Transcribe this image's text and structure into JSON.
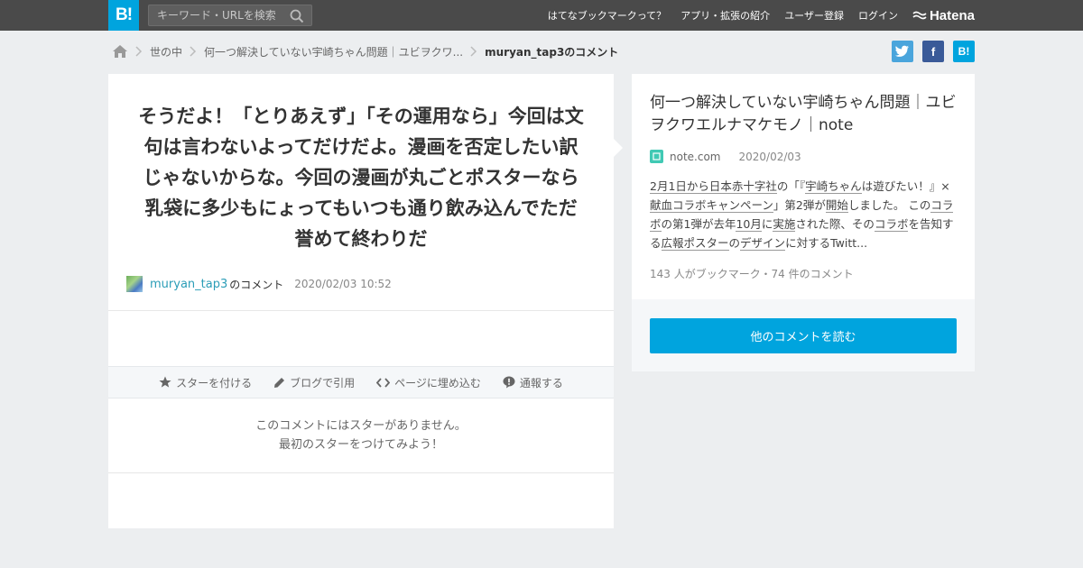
{
  "topbar": {
    "logo": "B!",
    "search_placeholder": "キーワード・URLを検索",
    "nav": [
      "はてなブックマークって？",
      "アプリ・拡張の紹介",
      "ユーザー登録",
      "ログイン"
    ],
    "brand": "Hatena"
  },
  "breadcrumb": {
    "items": [
      "世の中",
      "何一つ解決していない宇崎ちゃん問題｜ユビヲクワ..."
    ],
    "current": "muryan_tap3のコメント"
  },
  "share": {
    "facebook": "f",
    "hatena": "B!"
  },
  "comment": {
    "text": "そうだよ！「とりあえず」「その運用なら」今回は文句は言わないよってだけだよ。漫画を否定したい訳じゃないからな。今回の漫画が丸ごとポスターなら乳袋に多少もにょってもいつも通り飲み込んでただ誉めて終わりだ",
    "username": "muryan_tap3",
    "no_comment": "のコメント",
    "date": "2020/02/03 10:52"
  },
  "actions": {
    "star": "スターを付ける",
    "blog": "ブログで引用",
    "embed": "ページに埋め込む",
    "report": "通報する"
  },
  "no_stars": {
    "line1": "このコメントにはスターがありません。",
    "line2": "最初のスターをつけてみよう！"
  },
  "entry": {
    "title": "何一つ解決していない宇崎ちゃん問題｜ユビヲクワエルナマケモノ｜note",
    "domain": "note.com",
    "date": "2020/02/03",
    "summary_parts": [
      {
        "t": "2月1日から日本赤十字社",
        "u": true
      },
      {
        "t": "の「『",
        "u": false
      },
      {
        "t": "宇崎ちゃん",
        "u": true
      },
      {
        "t": "は遊びたい！』×",
        "u": false
      },
      {
        "t": "献血",
        "u": true
      },
      {
        "t": "コラボキャンペーン",
        "u": true
      },
      {
        "t": "」第2弾が",
        "u": false
      },
      {
        "t": "開始",
        "u": true
      },
      {
        "t": "しました。 この",
        "u": false
      },
      {
        "t": "コラボ",
        "u": true
      },
      {
        "t": "の第1弾が去年",
        "u": false
      },
      {
        "t": "10月",
        "u": true
      },
      {
        "t": "に",
        "u": false
      },
      {
        "t": "実施",
        "u": true
      },
      {
        "t": "された際、その",
        "u": false
      },
      {
        "t": "コラボ",
        "u": true
      },
      {
        "t": "を告知する",
        "u": false
      },
      {
        "t": "広報ポスター",
        "u": true
      },
      {
        "t": "の",
        "u": false
      },
      {
        "t": "デザイン",
        "u": true
      },
      {
        "t": "に対するTwitt...",
        "u": false
      }
    ],
    "stats": "143 人がブックマーク・74 件のコメント",
    "read_button": "他のコメントを読む"
  },
  "colors": {
    "accent": "#00a4de",
    "topbar": "#4a4a4a",
    "link": "#2b9db7",
    "twitter": "#4aa5dc",
    "facebook": "#3a5a98"
  }
}
